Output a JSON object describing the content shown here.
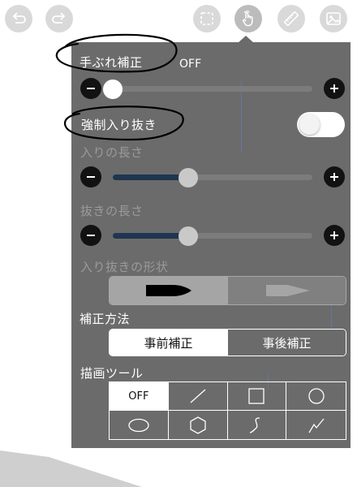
{
  "toolbar": {
    "buttons": [
      {
        "name": "undo-button",
        "icon": "undo-icon"
      },
      {
        "name": "redo-button",
        "icon": "redo-icon"
      },
      {
        "name": "selection-tool-button",
        "icon": "dashed-select-icon"
      },
      {
        "name": "touch-tool-button",
        "icon": "hand-pointer-icon",
        "selected": true
      },
      {
        "name": "ruler-tool-button",
        "icon": "ruler-icon"
      },
      {
        "name": "image-button",
        "icon": "image-icon"
      }
    ]
  },
  "stabilizer": {
    "label": "手ぶれ補正",
    "value": "OFF",
    "level": 0.0
  },
  "force_taper": {
    "label": "強制入り抜き",
    "on": false
  },
  "taper_in": {
    "label": "入りの長さ",
    "level": 0.38
  },
  "taper_out": {
    "label": "抜きの長さ",
    "level": 0.38
  },
  "taper_shape": {
    "label": "入り抜きの形状",
    "options": [
      "bullet-shape-icon",
      "arrow-shape-icon"
    ],
    "selected": 0
  },
  "correction_method": {
    "label": "補正方法",
    "options": [
      "事前補正",
      "事後補正"
    ],
    "selected": 0
  },
  "drawing_tool": {
    "label": "描画ツール",
    "off_label": "OFF",
    "cells": [
      "off",
      "line-icon",
      "rectangle-icon",
      "circle-icon",
      "ellipse-icon",
      "hexagon-icon",
      "curve-icon",
      "polyline-icon"
    ],
    "selected": 0
  },
  "colors": {
    "panel": "#6b6b6b",
    "track_fill": "#1f3550",
    "annotation": "#000000"
  }
}
